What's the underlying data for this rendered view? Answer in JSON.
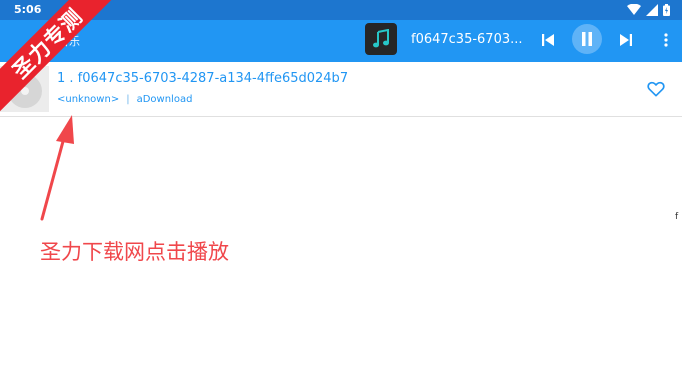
{
  "status_bar": {
    "time": "5:06"
  },
  "app_bar": {
    "title": "音乐",
    "now_playing": "f0647c35-6703...",
    "icons": {
      "album_art": "music-note-icon",
      "prev": "skip-previous-icon",
      "pause": "pause-icon",
      "next": "skip-next-icon",
      "more": "more-vert-icon"
    }
  },
  "songs": [
    {
      "title": "1 . f0647c35-6703-4287-a134-4ffe65d024b7",
      "artist": "<unknown>",
      "separator": "|",
      "album": "aDownload",
      "favorite_icon": "heart-outline-icon"
    }
  ],
  "overlay": {
    "banner": "圣力专测",
    "annotation": "圣力下载网点击播放",
    "edge_char": "f"
  },
  "colors": {
    "app_bar": "#2196f3",
    "status_bar": "#1d76cf",
    "accent_text": "#2196f3",
    "banner": "#e9232d",
    "annotation": "#f0474b",
    "album_note": "#27c7c7"
  }
}
